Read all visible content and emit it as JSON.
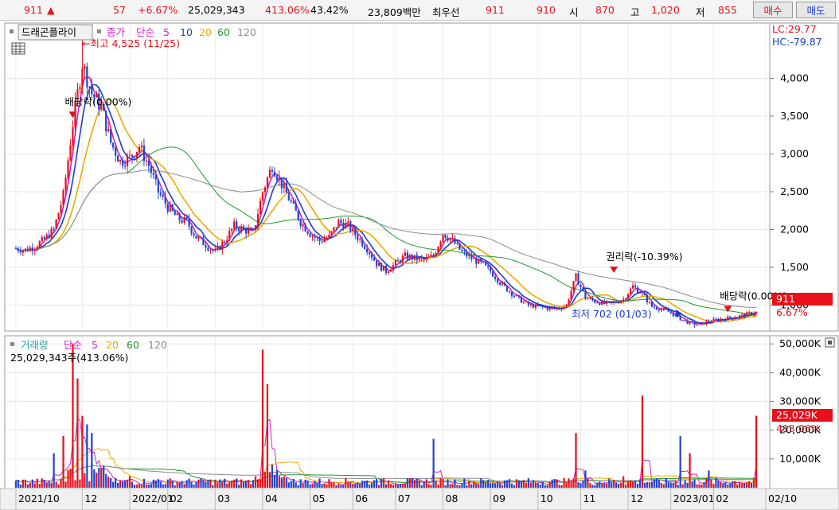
{
  "quote_bar": {
    "price": "911",
    "direction": "▲",
    "change": "57",
    "change_pct": "+6.67%",
    "volume": "25,029,343",
    "volume_ratio": "413.06%",
    "turnover_rate": "43.42%",
    "trade_value": "23,809백만",
    "best_bid_label": "최우선",
    "best_ask": "911",
    "best_bid": "910",
    "open_label": "시",
    "open": "870",
    "high_label": "고",
    "high": "1,020",
    "low_label": "저",
    "low": "855",
    "buy_label": "매수",
    "sell_label": "매도"
  },
  "price_panel": {
    "tool_label": "드래곤플라이",
    "legend": {
      "type": "종가",
      "method": "단순",
      "periods": [
        "5",
        "10",
        "20",
        "60",
        "120"
      ]
    },
    "lc_label": "LC:29.77",
    "hc_label": "HC:-79.87",
    "high_marker": "←최고 4,525 (11/25)",
    "low_marker": "최저 702 (01/03)",
    "annotations": [
      {
        "text": "배당락(0.00%)",
        "x": 6,
        "y": 3560
      },
      {
        "text": "권리락(-10.39%)",
        "x": 63,
        "y": 1510
      },
      {
        "text": "배당락(0.00%)",
        "x": 75,
        "y": 990
      }
    ],
    "current_price_tag": "911",
    "current_change_tag": "6.67%"
  },
  "volume_panel": {
    "legend": {
      "type": "거래량",
      "method": "단순",
      "periods": [
        "5",
        "20",
        "60",
        "120"
      ]
    },
    "current_volume_label": "25,029,343주(413.06%)",
    "current_volume_tag": "25,029K",
    "current_ratio_tag": "413.06%"
  },
  "x_axis_labels": [
    {
      "text": "2021/10",
      "x": 0
    },
    {
      "text": "12",
      "x": 7
    },
    {
      "text": "2022/01",
      "x": 12
    },
    {
      "text": "02",
      "x": 16
    },
    {
      "text": "03",
      "x": 21
    },
    {
      "text": "04",
      "x": 26
    },
    {
      "text": "05",
      "x": 31
    },
    {
      "text": "06",
      "x": 35.5
    },
    {
      "text": "07",
      "x": 40
    },
    {
      "text": "08",
      "x": 45
    },
    {
      "text": "09",
      "x": 50
    },
    {
      "text": "10",
      "x": 55
    },
    {
      "text": "11",
      "x": 59.5
    },
    {
      "text": "12",
      "x": 64.5
    },
    {
      "text": "2023/01",
      "x": 69
    },
    {
      "text": "02",
      "x": 73.5
    },
    {
      "text": "02/10",
      "x": 79
    }
  ],
  "colors": {
    "up": "#e8101a",
    "down": "#2143d6",
    "ma5": "#d020c8",
    "ma10": "#1e3cc8",
    "ma20": "#f0a800",
    "ma60": "#1e9a2a",
    "ma120": "#8c8c8c"
  },
  "chart_data": [
    {
      "type": "candlestick",
      "title": "",
      "xlabel": "",
      "ylabel": "",
      "y_ticks": [
        "1,000",
        "1,500",
        "2,000",
        "2,500",
        "3,000",
        "3,500",
        "4,000"
      ],
      "ylim": [
        700,
        4700
      ],
      "xlim": [
        -1,
        79
      ],
      "grid": true,
      "close_anchors": [
        [
          0,
          1750
        ],
        [
          1,
          1730
        ],
        [
          2,
          1780
        ],
        [
          3,
          1870
        ],
        [
          4,
          2000
        ],
        [
          5,
          2450
        ],
        [
          6,
          3400
        ],
        [
          7,
          4200
        ],
        [
          8,
          3800
        ],
        [
          9,
          3620
        ],
        [
          10,
          3150
        ],
        [
          11,
          2900
        ],
        [
          12,
          2950
        ],
        [
          13,
          3100
        ],
        [
          14,
          2850
        ],
        [
          15,
          2500
        ],
        [
          16,
          2300
        ],
        [
          17,
          2150
        ],
        [
          18,
          2100
        ],
        [
          19,
          1900
        ],
        [
          20,
          1800
        ],
        [
          21,
          1700
        ],
        [
          22,
          1850
        ],
        [
          23,
          2050
        ],
        [
          24,
          2000
        ],
        [
          25,
          1950
        ],
        [
          26,
          2500
        ],
        [
          27,
          2850
        ],
        [
          28,
          2600
        ],
        [
          29,
          2350
        ],
        [
          30,
          2100
        ],
        [
          31,
          1950
        ],
        [
          32,
          1850
        ],
        [
          33,
          1900
        ],
        [
          34,
          2100
        ],
        [
          35,
          2050
        ],
        [
          36,
          1900
        ],
        [
          37,
          1750
        ],
        [
          38,
          1550
        ],
        [
          39,
          1450
        ],
        [
          40,
          1550
        ],
        [
          41,
          1650
        ],
        [
          42,
          1620
        ],
        [
          43,
          1600
        ],
        [
          44,
          1650
        ],
        [
          45,
          1950
        ],
        [
          46,
          1850
        ],
        [
          47,
          1700
        ],
        [
          48,
          1620
        ],
        [
          49,
          1550
        ],
        [
          50,
          1450
        ],
        [
          51,
          1300
        ],
        [
          52,
          1180
        ],
        [
          53,
          1080
        ],
        [
          54,
          1000
        ],
        [
          55,
          980
        ],
        [
          56,
          960
        ],
        [
          57,
          950
        ],
        [
          58,
          1000
        ],
        [
          59,
          1380
        ],
        [
          60,
          1100
        ],
        [
          61,
          1050
        ],
        [
          62,
          1020
        ],
        [
          63,
          1030
        ],
        [
          64,
          1080
        ],
        [
          65,
          1250
        ],
        [
          66,
          1150
        ],
        [
          67,
          980
        ],
        [
          68,
          950
        ],
        [
          69,
          900
        ],
        [
          70,
          820
        ],
        [
          71,
          760
        ],
        [
          72,
          740
        ],
        [
          73,
          790
        ],
        [
          74,
          810
        ],
        [
          75,
          830
        ],
        [
          76,
          850
        ],
        [
          77,
          880
        ],
        [
          78,
          911
        ]
      ],
      "annotated_points": [
        {
          "label": "high",
          "x": 7,
          "y": 4525
        },
        {
          "label": "low",
          "x": 71.5,
          "y": 702
        },
        {
          "label": "last",
          "x": 78,
          "y": 911
        }
      ],
      "series": [
        {
          "name": "5",
          "color": "#d020c8",
          "window": 1
        },
        {
          "name": "10",
          "color": "#1e3cc8",
          "window": 2
        },
        {
          "name": "20",
          "color": "#f0a800",
          "window": 4
        },
        {
          "name": "60",
          "color": "#1e9a2a",
          "window": 12
        },
        {
          "name": "120",
          "color": "#8c8c8c",
          "window": 24
        }
      ]
    },
    {
      "type": "bar",
      "title": "",
      "y_ticks": [
        "10,000K",
        "20,000K",
        "30,000K",
        "40,000K",
        "50,000K"
      ],
      "ylim": [
        0,
        52000
      ],
      "spikes": [
        [
          4.0,
          12000
        ],
        [
          5.0,
          18000
        ],
        [
          6.0,
          50000
        ],
        [
          6.5,
          38000
        ],
        [
          7.0,
          25000
        ],
        [
          7.5,
          22000
        ],
        [
          8.0,
          19000
        ],
        [
          12.0,
          4000
        ],
        [
          15.0,
          3000
        ],
        [
          24.0,
          2000
        ],
        [
          26.0,
          48000
        ],
        [
          26.5,
          36000
        ],
        [
          27.0,
          8000
        ],
        [
          33.0,
          3000
        ],
        [
          38.0,
          3000
        ],
        [
          44.0,
          17000
        ],
        [
          52.0,
          3000
        ],
        [
          59.0,
          19000
        ],
        [
          60.0,
          6000
        ],
        [
          64.0,
          4000
        ],
        [
          66.0,
          32000
        ],
        [
          70.0,
          18000
        ],
        [
          71.0,
          12000
        ],
        [
          73.0,
          6000
        ],
        [
          78.0,
          25029
        ]
      ],
      "current_volume_k": 25029
    }
  ]
}
